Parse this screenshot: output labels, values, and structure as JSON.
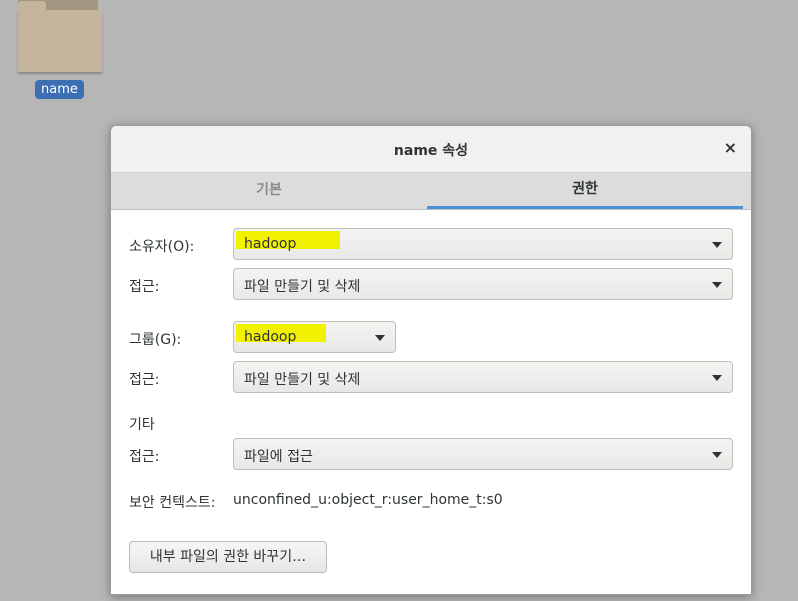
{
  "desktop": {
    "folder_label": "name"
  },
  "dialog": {
    "title": "name 속성",
    "close_glyph": "×",
    "tabs": [
      {
        "label": "기본",
        "active": false
      },
      {
        "label": "권한",
        "active": true
      }
    ]
  },
  "permissions": {
    "owner_label": "소유자(O):",
    "owner_value": "hadoop",
    "owner_access_label": "접근:",
    "owner_access_value": "파일 만들기 및 삭제",
    "group_label": "그룹(G):",
    "group_value": "hadoop",
    "group_access_label": "접근:",
    "group_access_value": "파일 만들기 및 삭제",
    "others_section": "기타",
    "others_access_label": "접근:",
    "others_access_value": "파일에 접근",
    "security_context_label": "보안 컨텍스트:",
    "security_context_value": "unconfined_u:object_r:user_home_t:s0",
    "change_button_label": "내부 파일의 권한 바꾸기…"
  },
  "colors": {
    "highlight": "#f2f200",
    "accent": "#4a90d9",
    "selection": "#3c6eb4"
  }
}
